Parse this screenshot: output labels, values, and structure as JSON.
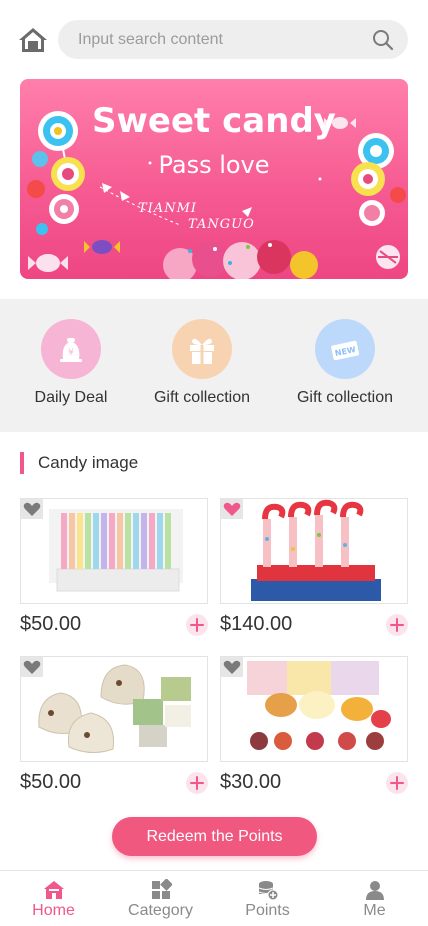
{
  "header": {
    "home_icon": "home-icon",
    "search_placeholder": "Input search content",
    "search_icon": "search-icon"
  },
  "banner": {
    "title": "Sweet candy",
    "subtitle": "Pass love",
    "brand_line1": "TIANMI",
    "brand_line2": "TANGUO"
  },
  "quick_entries": [
    {
      "label": "Daily Deal",
      "icon": "yen-bag-icon",
      "color": "#f7b5d6"
    },
    {
      "label": "Gift collection",
      "icon": "gift-icon",
      "color": "#f8d3b1"
    },
    {
      "label": "Gift collection",
      "icon": "new-tag-icon",
      "color": "#bcd9fb"
    }
  ],
  "section": {
    "title": "Candy image"
  },
  "products": [
    {
      "price": "$50.00",
      "image": "pastel-candy-canes-box",
      "favorited": false
    },
    {
      "price": "$140.00",
      "image": "red-candy-cane-tubes",
      "favorited": true
    },
    {
      "price": "$50.00",
      "image": "wrapped-nougat-candies",
      "favorited": false
    },
    {
      "price": "$30.00",
      "image": "fruit-gummies-packs",
      "favorited": false
    }
  ],
  "redeem_label": "Redeem the Points",
  "tabbar": {
    "items": [
      {
        "label": "Home",
        "icon": "home-icon",
        "active": true
      },
      {
        "label": "Category",
        "icon": "grid-icon",
        "active": false
      },
      {
        "label": "Points",
        "icon": "coins-icon",
        "active": false
      },
      {
        "label": "Me",
        "icon": "user-icon",
        "active": false
      }
    ]
  },
  "colors": {
    "accent": "#f0578a",
    "banner": "#f65b92",
    "fav_active": "#f0578a",
    "fav_inactive": "#7a7a7a"
  }
}
